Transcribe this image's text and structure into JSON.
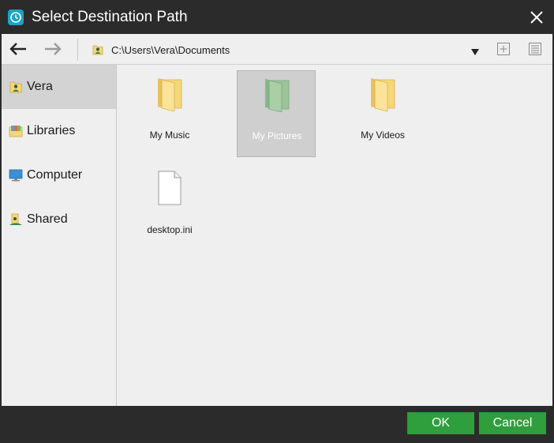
{
  "window": {
    "title": "Select Destination Path"
  },
  "toolbar": {
    "back_icon": "arrow-left-icon",
    "forward_icon": "arrow-right-icon",
    "path": "C:\\Users\\Vera\\Documents",
    "path_icon": "user-folder-icon",
    "dropdown_icon": "triangle-down-icon",
    "new_folder_icon": "plus-square-icon",
    "view_icon": "list-view-icon"
  },
  "sidebar": {
    "items": [
      {
        "label": "Vera",
        "icon": "user-folder-icon",
        "selected": true
      },
      {
        "label": "Libraries",
        "icon": "libraries-icon",
        "selected": false
      },
      {
        "label": "Computer",
        "icon": "monitor-icon",
        "selected": false
      },
      {
        "label": "Shared",
        "icon": "shared-folder-icon",
        "selected": false
      }
    ]
  },
  "files": [
    {
      "label": "My Music",
      "icon": "folder-icon",
      "selected": false
    },
    {
      "label": "My Pictures",
      "icon": "folder-icon",
      "selected": true
    },
    {
      "label": "My Videos",
      "icon": "folder-icon",
      "selected": false
    },
    {
      "label": "desktop.ini",
      "icon": "file-icon",
      "selected": false
    }
  ],
  "footer": {
    "ok_label": "OK",
    "cancel_label": "Cancel"
  },
  "colors": {
    "accent_button": "#2f9e3c",
    "app_icon": "#1aa3c9",
    "folder": "#f5d77a",
    "folder_selected": "#9cc49a"
  }
}
